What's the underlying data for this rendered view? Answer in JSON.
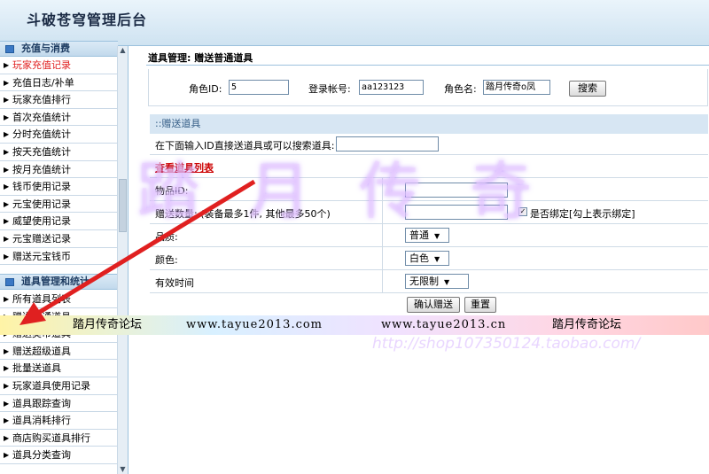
{
  "app": {
    "title": "斗破苍穹管理后台"
  },
  "sidebar": {
    "group1": {
      "label": "充值与消费"
    },
    "group1_items": [
      {
        "label": "玩家充值记录",
        "active": true
      },
      {
        "label": "充值日志/补单"
      },
      {
        "label": "玩家充值排行"
      },
      {
        "label": "首次充值统计"
      },
      {
        "label": "分时充值统计"
      },
      {
        "label": "按天充值统计"
      },
      {
        "label": "按月充值统计"
      },
      {
        "label": "钱币使用记录"
      },
      {
        "label": "元宝使用记录"
      },
      {
        "label": "威望使用记录"
      },
      {
        "label": "元宝赠送记录"
      },
      {
        "label": "赠送元宝钱币"
      }
    ],
    "group2": {
      "label": "道具管理和统计"
    },
    "group2_items": [
      {
        "label": "所有道具列表"
      },
      {
        "label": "赠送普通道具"
      },
      {
        "label": "赠送类币道具"
      },
      {
        "label": "赠送超级道具"
      },
      {
        "label": "批量送道具"
      },
      {
        "label": "玩家道具使用记录"
      },
      {
        "label": "道具跟踪查询"
      },
      {
        "label": "道具消耗排行"
      },
      {
        "label": "商店购买道具排行"
      },
      {
        "label": "道具分类查询"
      }
    ]
  },
  "main": {
    "breadcrumb": "道具管理: 赠送普通道具",
    "search": {
      "role_id_label": "角色ID:",
      "role_id_value": "5",
      "account_label": "登录帐号:",
      "account_value": "aa123123",
      "role_name_label": "角色名:",
      "role_name_value": "踏月传奇o凤",
      "search_button": "搜索"
    },
    "section_title": "::赠送道具",
    "direct_input_label": "在下面输入ID直接送道具或可以搜索道具:",
    "item_list_link": "查看道具列表",
    "fields": {
      "item_id_label": "物品ID:",
      "quantity_label": "赠送数量: (装备最多1件, 其他最多50个)",
      "bind_label": "是否绑定[勾上表示绑定]",
      "quality_label": "品质:",
      "quality_value": "普通",
      "color_label": "颜色:",
      "color_value": "白色",
      "expiry_label": "有效时间",
      "expiry_value": "无限制"
    },
    "confirm_button": "确认赠送",
    "reset_button": "重置"
  },
  "overlay": {
    "watermark_text": "踏月传奇",
    "shop_text": "http://shop107350124.taobao.com/",
    "banner": {
      "left_text": "踏月传奇论坛",
      "url1": "www.tayue2013.com",
      "url2": "www.tayue2013.cn",
      "right_text": "踏月传奇论坛"
    },
    "arrow_color": "#e02020"
  }
}
